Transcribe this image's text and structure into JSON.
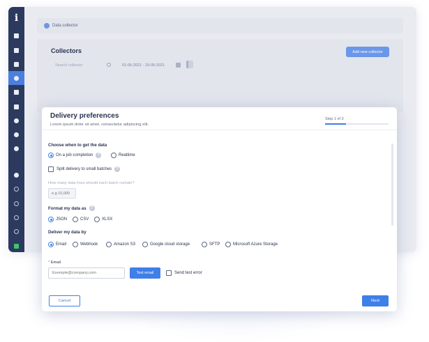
{
  "colors": {
    "accent": "#3f7fe8",
    "sidebar": "#2b3a5e",
    "sidebar_active": "#4a7fe0",
    "background": "#f2f3f7"
  },
  "sidebar": {
    "logo": "i",
    "items": [
      {
        "icon": "dashboard-icon"
      },
      {
        "icon": "stack-icon"
      },
      {
        "icon": "diamond-icon"
      },
      {
        "icon": "data-collector-icon",
        "active": true
      },
      {
        "icon": "cloud-icon"
      },
      {
        "icon": "calendar-icon"
      },
      {
        "icon": "target-icon"
      },
      {
        "icon": "zoom-icon"
      },
      {
        "icon": "help-icon"
      },
      {
        "icon": "clock-icon"
      },
      {
        "icon": "billing-icon"
      },
      {
        "icon": "settings-icon"
      },
      {
        "icon": "support-icon"
      },
      {
        "icon": "logout-icon"
      },
      {
        "icon": "status-icon"
      }
    ]
  },
  "breadcrumb": {
    "label": "Data collector"
  },
  "collectors": {
    "title": "Collectors",
    "add_button": "Add new collector",
    "search_placeholder": "Search collector",
    "date_range": "01-05-2021 - 15-05-2021"
  },
  "modal": {
    "title": "Delivery preferences",
    "subtitle": "Lorem ipsum dolor sit amet, consectetur adipiscing elit.",
    "step_label": "Step 1 of 3",
    "step_progress": 0.33,
    "when": {
      "heading": "Choose when to get the data",
      "options": [
        "On a job completion",
        "Realtime"
      ],
      "selected": "On a job completion",
      "split_label": "Split delivery to small batches",
      "batch_hint": "How many data lines should each batch contain?",
      "batch_placeholder": "e.g 10,000"
    },
    "format": {
      "heading": "Format my data as",
      "options": [
        "JSON",
        "CSV",
        "XLSX"
      ],
      "selected": "JSON"
    },
    "deliver": {
      "heading": "Deliver my data by",
      "options": [
        "Email",
        "Webhook",
        "Amazon S3",
        "Google cloud storage",
        "SFTP",
        "Microsoft Azure Storage"
      ],
      "selected": "Email"
    },
    "email": {
      "label": "Email",
      "required_mark": "*",
      "placeholder": "Exemple@company.com",
      "test_button": "Test email",
      "send_error_label": "Send test error"
    },
    "cancel_button": "Cancel",
    "next_button": "Next"
  }
}
